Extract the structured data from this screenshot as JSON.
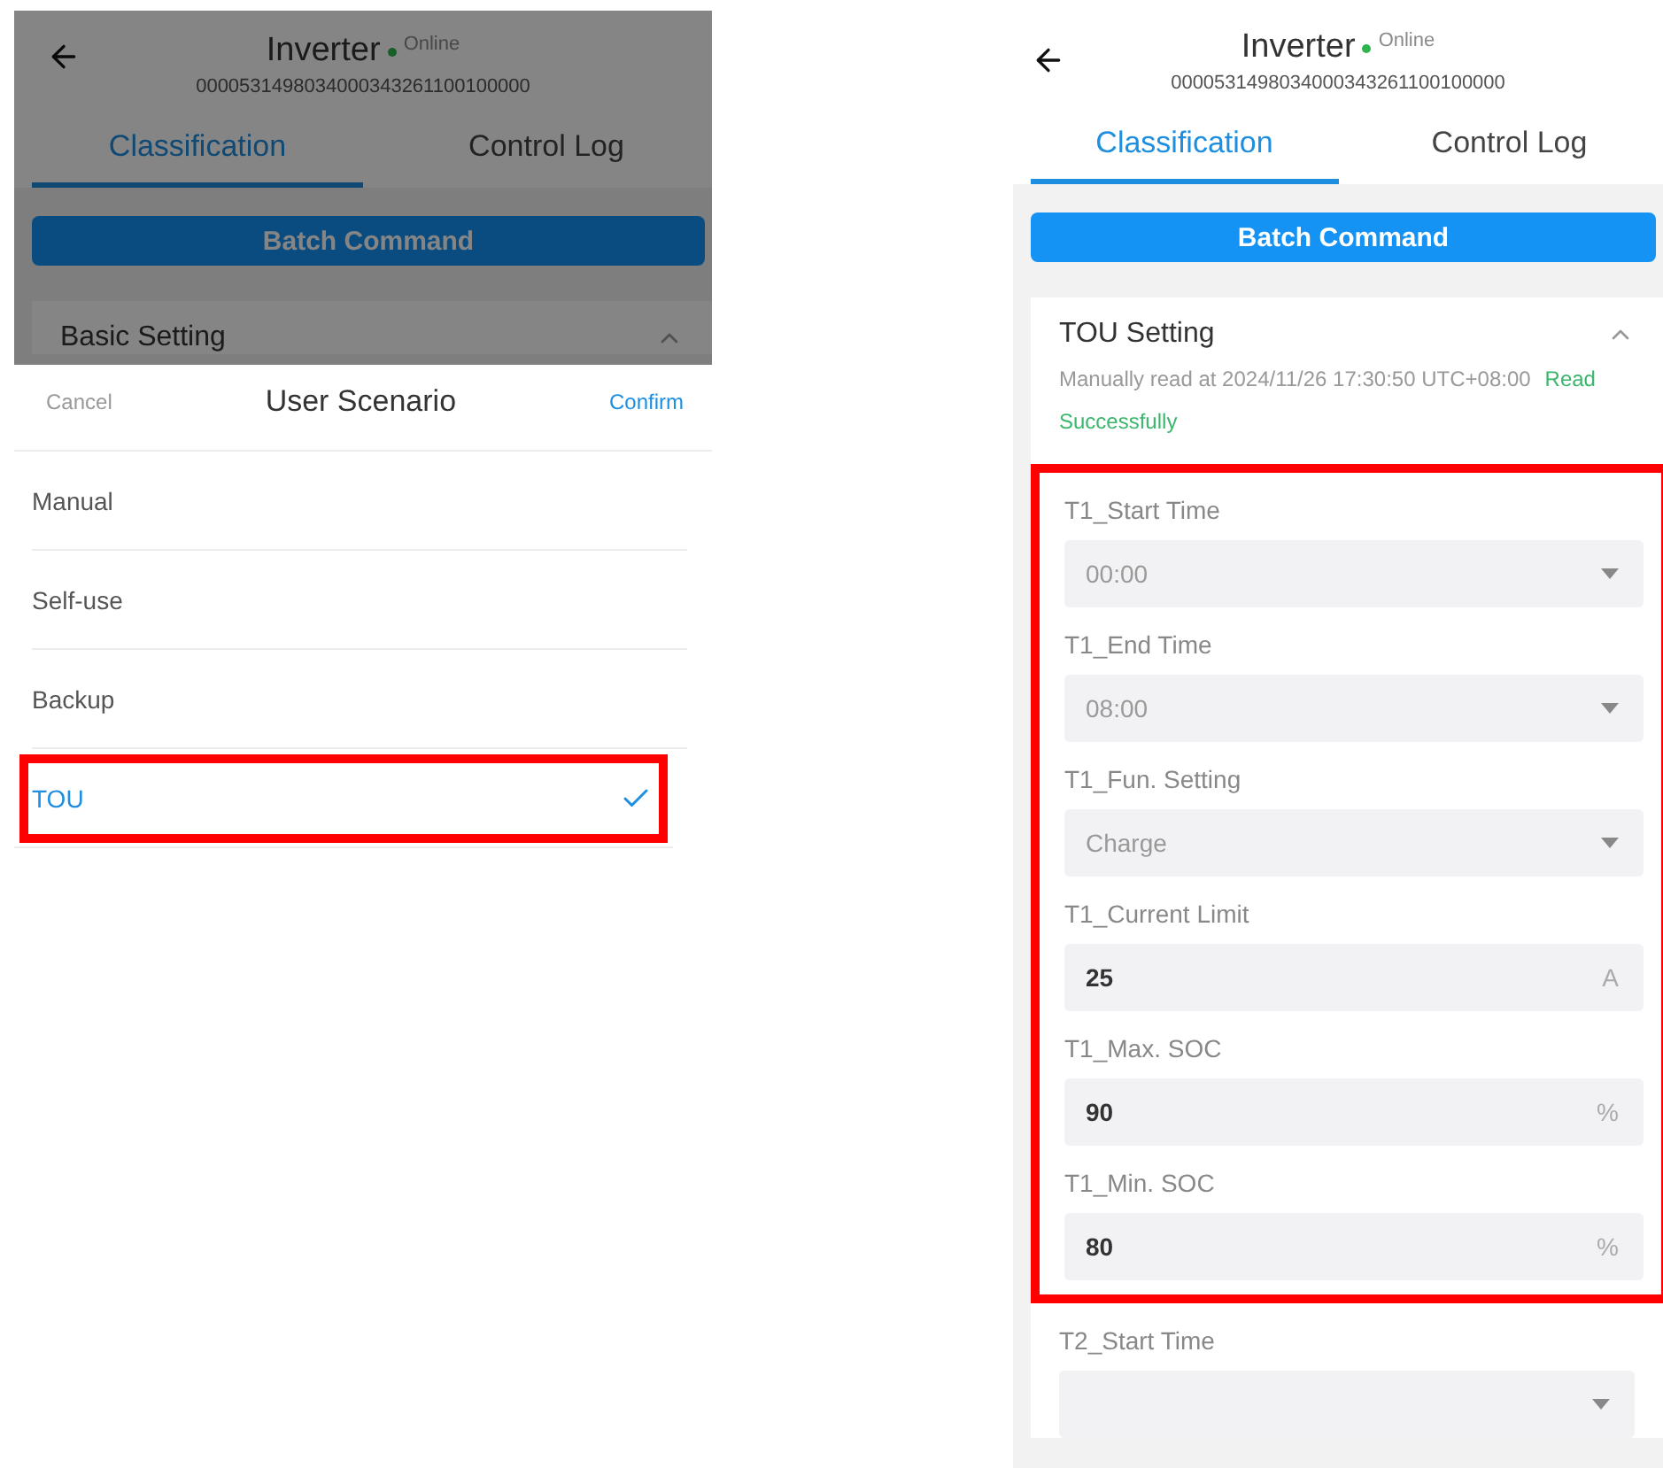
{
  "left_screen": {
    "header": {
      "title": "Inverter",
      "status": "Online",
      "serial": "0000531498034000343261100100000"
    },
    "tabs": [
      {
        "label": "Classification",
        "selected": true
      },
      {
        "label": "Control Log",
        "selected": false
      }
    ],
    "batch_button": "Batch Command",
    "section": {
      "title": "Basic Setting",
      "expanded": true
    },
    "sheet": {
      "open": true,
      "cancel": "Cancel",
      "title": "User Scenario",
      "confirm": "Confirm",
      "options": [
        {
          "label": "Manual",
          "selected": false,
          "highlighted": false
        },
        {
          "label": "Self-use",
          "selected": false,
          "highlighted": false
        },
        {
          "label": "Backup",
          "selected": false,
          "highlighted": false
        },
        {
          "label": "TOU",
          "selected": true,
          "highlighted": true
        }
      ]
    }
  },
  "right_screen": {
    "header": {
      "title": "Inverter",
      "status": "Online",
      "serial": "0000531498034000343261100100000"
    },
    "tabs": [
      {
        "label": "Classification",
        "selected": true
      },
      {
        "label": "Control Log",
        "selected": false
      }
    ],
    "batch_button": "Batch Command",
    "section": {
      "title": "TOU Setting",
      "expanded": true,
      "read_note": "Manually read at 2024/11/26 17:30:50 UTC+08:00",
      "read_status": "Read Successfully",
      "fields_highlighted": true,
      "fields": [
        {
          "label": "T1_Start Time",
          "kind": "select",
          "value": "00:00"
        },
        {
          "label": "T1_End Time",
          "kind": "select",
          "value": "08:00"
        },
        {
          "label": "T1_Fun. Setting",
          "kind": "select",
          "value": "Charge"
        },
        {
          "label": "T1_Current Limit",
          "kind": "number",
          "value": "25",
          "unit": "A"
        },
        {
          "label": "T1_Max. SOC",
          "kind": "number",
          "value": "90",
          "unit": "%"
        },
        {
          "label": "T1_Min. SOC",
          "kind": "number",
          "value": "80",
          "unit": "%"
        }
      ],
      "next_fields": [
        {
          "label": "T2_Start Time",
          "kind": "select"
        }
      ]
    }
  }
}
